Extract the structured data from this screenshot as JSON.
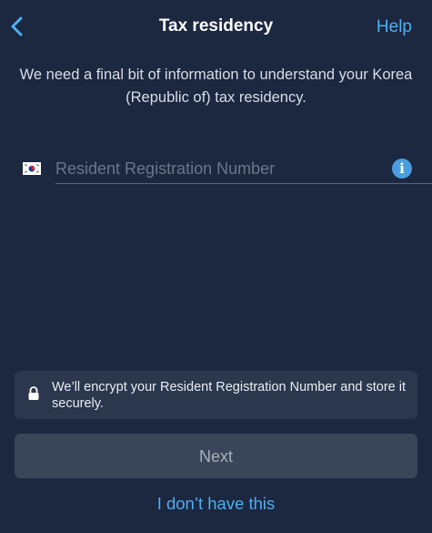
{
  "header": {
    "title": "Tax residency",
    "help_label": "Help",
    "back_icon": "chevron-left-icon"
  },
  "intro": {
    "text": "We need a final bit of information to understand your Korea (Republic of) tax residency."
  },
  "rrn_field": {
    "flag_icon": "south-korea-flag-icon",
    "placeholder": "Resident Registration Number",
    "value": "",
    "info_icon": "info-icon",
    "info_symbol": "i"
  },
  "notice": {
    "icon": "lock-icon",
    "text": "We’ll encrypt your Resident Registration Number and store it securely."
  },
  "actions": {
    "next_label": "Next",
    "no_have_label": "I don’t have this"
  },
  "colors": {
    "background": "#1c2740",
    "accent": "#4eaff0",
    "info": "#4a9ee0",
    "panel": "#2b374d",
    "button_disabled": "#3b4559"
  }
}
